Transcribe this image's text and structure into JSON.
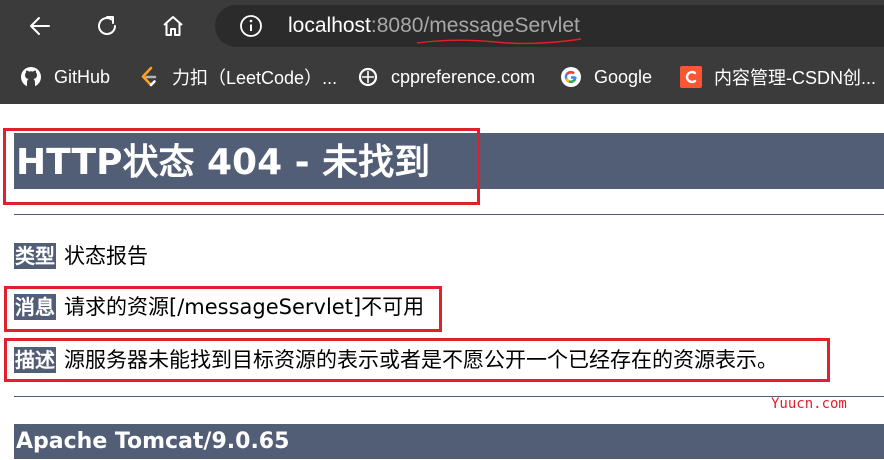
{
  "browser": {
    "address": {
      "host": "localhost",
      "rest": ":8080/messageServlet"
    },
    "bookmarks": [
      {
        "label": "GitHub",
        "icon": "github-icon"
      },
      {
        "label": "力扣（LeetCode）...",
        "icon": "leetcode-icon"
      },
      {
        "label": "cppreference.com",
        "icon": "cppreference-icon"
      },
      {
        "label": "Google",
        "icon": "google-icon"
      },
      {
        "label": "内容管理-CSDN创...",
        "icon": "csdn-icon"
      }
    ],
    "colors": {
      "chrome_bg": "#3b3b3b",
      "address_bg": "#2b2b2b"
    }
  },
  "page": {
    "title": "HTTP状态 404 - 未找到",
    "rows": [
      {
        "label": "类型",
        "value": "状态报告"
      },
      {
        "label": "消息",
        "value": "请求的资源[/messageServlet]不可用"
      },
      {
        "label": "描述",
        "value": "源服务器未能找到目标资源的表示或者是不愿公开一个已经存在的资源表示。"
      }
    ],
    "footer": "Apache Tomcat/9.0.65",
    "watermark": "Yuucn.com",
    "colors": {
      "header_bg": "#525d76",
      "annotation_red": "#e0202c"
    }
  }
}
